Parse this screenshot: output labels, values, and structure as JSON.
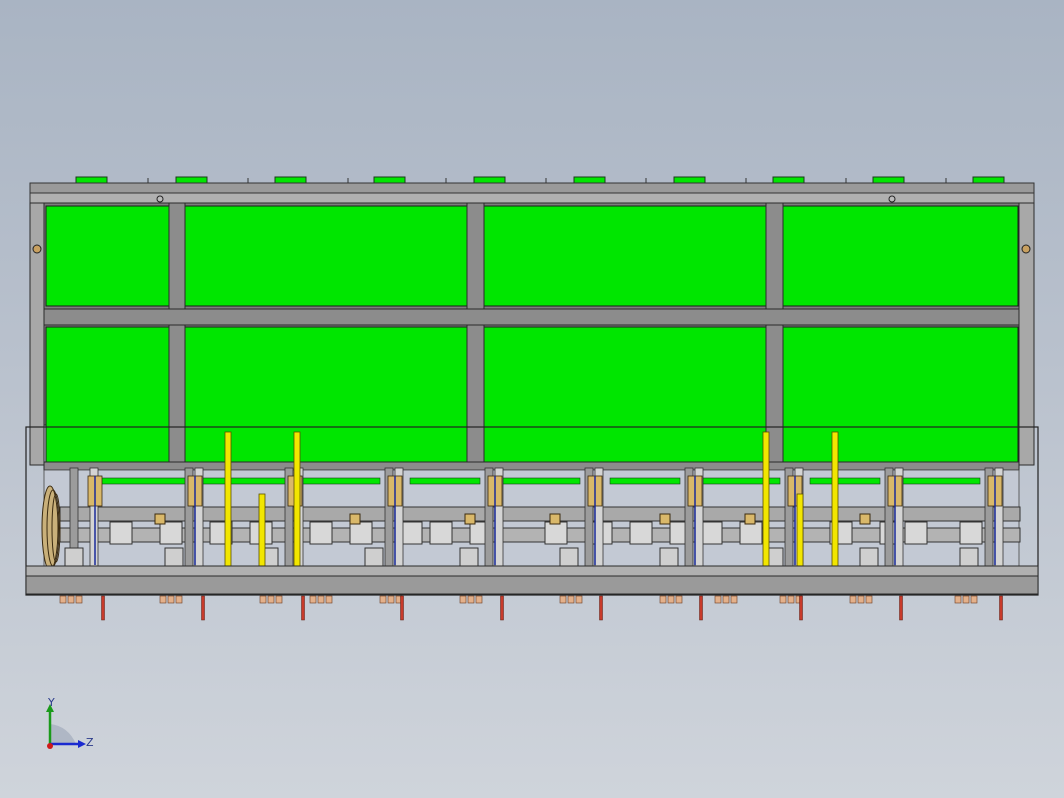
{
  "view": {
    "background_top": "#a9b4c3",
    "background_bottom": "#cfd4db",
    "frame_color": "#8a8a8a",
    "frame_dark": "#2a2a2a",
    "panel_color": "#00e600",
    "yellow_color": "#f2e600",
    "brass_color": "#d9b86a",
    "red_color": "#c83a2a"
  },
  "triad": {
    "y_label": "Y",
    "z_label": "Z"
  }
}
